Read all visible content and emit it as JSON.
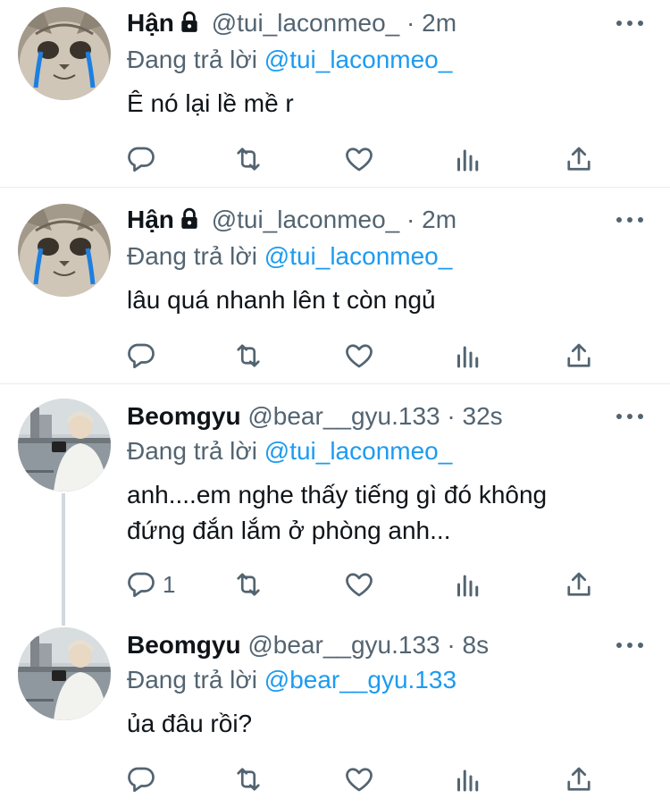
{
  "tweets": [
    {
      "name": "Hận",
      "handle": "@tui_laconmeo_",
      "dot": "·",
      "time": "2m",
      "reply_prefix": "Đang trả lời",
      "reply_to": "@tui_laconmeo_",
      "text": [
        "Ê nó lại lề mề r"
      ],
      "reply_count": "",
      "locked": true,
      "avatar": "crying-cat-avatar"
    },
    {
      "name": "Hận",
      "handle": "@tui_laconmeo_",
      "dot": "·",
      "time": "2m",
      "reply_prefix": "Đang trả lời",
      "reply_to": "@tui_laconmeo_",
      "text": [
        "lâu quá nhanh lên t còn ngủ"
      ],
      "reply_count": "",
      "locked": true,
      "avatar": "crying-cat-avatar"
    },
    {
      "name": "Beomgyu",
      "handle": "@bear__gyu.133",
      "dot": "·",
      "time": "32s",
      "reply_prefix": "Đang trả lời",
      "reply_to": "@tui_laconmeo_",
      "text": [
        "anh....em nghe thấy tiếng gì đó không",
        "đứng đắn lắm ở phòng anh..."
      ],
      "reply_count": "1",
      "locked": false,
      "avatar": "person-photo-avatar"
    },
    {
      "name": "Beomgyu",
      "handle": "@bear__gyu.133",
      "dot": "·",
      "time": "8s",
      "reply_prefix": "Đang trả lời",
      "reply_to": "@bear__gyu.133",
      "text": [
        "ủa đâu rồi?"
      ],
      "reply_count": "",
      "locked": false,
      "avatar": "person-photo-avatar"
    }
  ],
  "colors": {
    "accent": "#1d9bf0",
    "secondary_text": "#536471",
    "primary_text": "#0f1419",
    "divider": "#e6ecf0"
  },
  "icons": [
    "reply-icon",
    "retweet-icon",
    "like-icon",
    "analytics-icon",
    "share-icon",
    "more-icon",
    "lock-icon"
  ]
}
